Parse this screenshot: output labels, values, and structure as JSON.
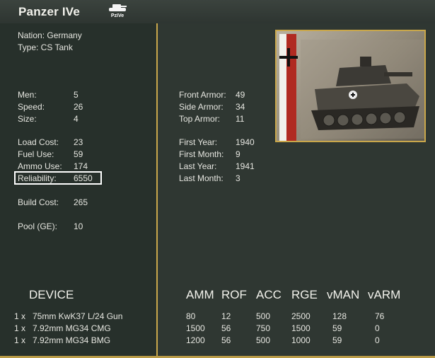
{
  "title": "Panzer IVe",
  "unit_icon_label": "PzIVe",
  "nation_line": "Nation: Germany",
  "type_line": "Type: CS Tank",
  "left_stats": [
    {
      "label": "Men:",
      "value": "5"
    },
    {
      "label": "Speed:",
      "value": "26"
    },
    {
      "label": "Size:",
      "value": "4"
    },
    {
      "label": "Load Cost:",
      "value": "23"
    },
    {
      "label": "Fuel Use:",
      "value": "59"
    },
    {
      "label": "Ammo Use:",
      "value": "174"
    },
    {
      "label": "Reliability:",
      "value": "6550"
    },
    {
      "label": "Build Cost:",
      "value": "265"
    },
    {
      "label": "Pool (GE):",
      "value": "10"
    }
  ],
  "armor_stats": [
    {
      "label": "Front Armor:",
      "value": "49"
    },
    {
      "label": "Side Armor:",
      "value": "34"
    },
    {
      "label": "Top Armor:",
      "value": "11"
    }
  ],
  "date_stats": [
    {
      "label": "First Year:",
      "value": "1940"
    },
    {
      "label": "First Month:",
      "value": "9"
    },
    {
      "label": "Last Year:",
      "value": "1941"
    },
    {
      "label": "Last Month:",
      "value": "3"
    }
  ],
  "device_table": {
    "device_header": "DEVICE",
    "columns": [
      "AMM",
      "ROF",
      "ACC",
      "RGE",
      "vMAN",
      "vARM"
    ],
    "rows": [
      {
        "qty": "1 x",
        "name": "75mm KwK37 L/24 Gun",
        "values": [
          "80",
          "12",
          "500",
          "2500",
          "128",
          "76"
        ]
      },
      {
        "qty": "1 x",
        "name": "7.92mm MG34 CMG",
        "values": [
          "1500",
          "56",
          "750",
          "1500",
          "59",
          "0"
        ]
      },
      {
        "qty": "1 x",
        "name": "7.92mm MG34 BMG",
        "values": [
          "1200",
          "56",
          "500",
          "1000",
          "59",
          "0"
        ]
      }
    ]
  },
  "colors": {
    "accent_border": "#c9a74b",
    "highlight": "#ffffff",
    "flag_red": "#b02a21"
  }
}
